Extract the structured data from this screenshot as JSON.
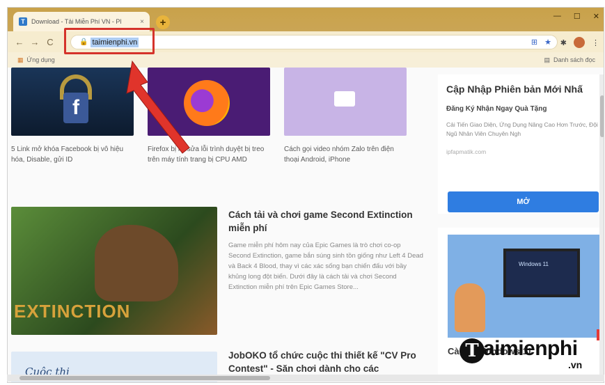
{
  "browser": {
    "tab_title": "Download - Tải Miễn Phí VN - Pl",
    "tab_close": "×",
    "new_tab": "+",
    "url": "taimienphi.vn",
    "bookmarks_left": "Ứng dụng",
    "bookmarks_right": "Danh sách đọc"
  },
  "articles": [
    {
      "caption": "5 Link mở khóa Facebook bị vô hiệu hóa, Disable, gửi ID"
    },
    {
      "caption": "Firefox bị lỗi sửa lỗi trình duyệt bị treo trên máy tính trang bị CPU AMD"
    },
    {
      "caption": "Cách gọi video nhóm Zalo trên điện thoại Android, iPhone"
    }
  ],
  "featured": {
    "title": "Cách tải và chơi game Second Extinction miễn phí",
    "summary": "Game miễn phí hôm nay của Epic Games là trò chơi co-op Second Extinction, game bắn súng sinh tồn giống như Left 4 Dead và Back 4 Blood, thay vì các xác sống bạn chiến đấu với bầy khủng long đột biến. Dưới đây là cách tải và chơi Second Extinction miễn phí trên Epic Games Store...",
    "image_text": "EXTINCTION"
  },
  "second": {
    "title": "JobOKO tổ chức cuộc thi thiết kế \"CV Pro Contest\" - Săn chơi dành cho các",
    "image_text": "Cuộc thi"
  },
  "ad": {
    "title": "Cập Nhập Phiên bản Mới Nhấ",
    "subtitle": "Đăng Ký Nhận Ngay Quà Tặng",
    "desc": "Cải Tiến Giao Diện, Ứng Dụng Nâng Cao Hơn Trước, Đội Ngũ Nhân Viên Chuyên Ngh",
    "domain": "ipfapmatik.com",
    "button": "MỞ"
  },
  "side_card": {
    "monitor_text": "Windows 11",
    "title_partial": "Cài đặt Windows 11 ISO"
  },
  "watermark": {
    "letter": "T",
    "name": "aimienphi",
    "domain": ".vn"
  },
  "colors": {
    "highlight": "#d5332b",
    "arrow": "#e0342b",
    "button": "#2f7de1"
  }
}
